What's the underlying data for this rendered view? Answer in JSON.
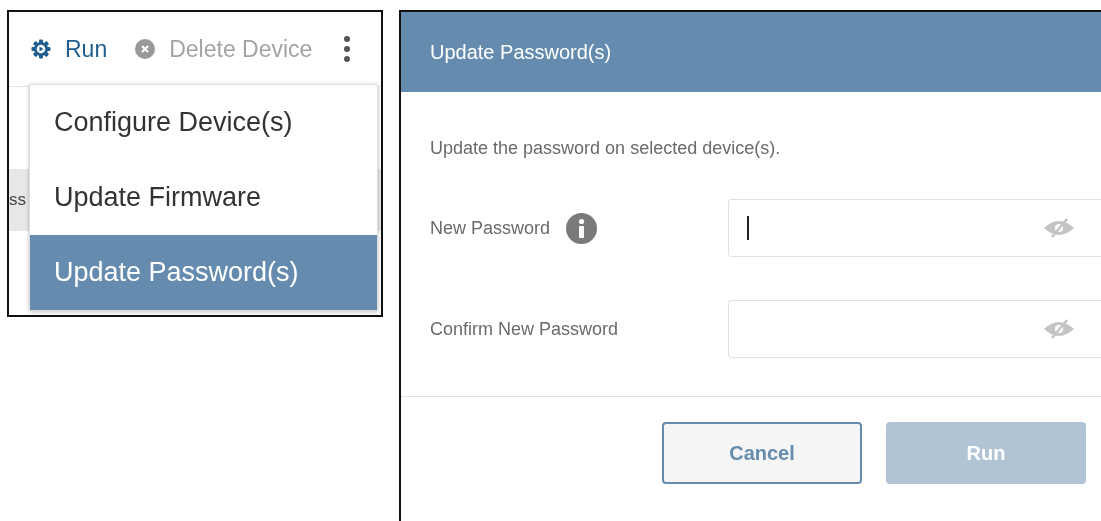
{
  "toolbar": [
    {
      "label": "Run",
      "kind": "run",
      "disabled": false
    },
    {
      "label": "Delete Device",
      "kind": "delete",
      "disabled": true
    }
  ],
  "table": {
    "column_1": "ss"
  },
  "menu": [
    {
      "label": "Configure Device(s)",
      "selected": false
    },
    {
      "label": "Update Firmware",
      "selected": false
    },
    {
      "label": "Update Password(s)",
      "selected": true
    }
  ],
  "dialog": {
    "title": "Update Password(s)",
    "description": "Update the password on selected device(s).",
    "fields": [
      {
        "label": "New Password",
        "info": true,
        "focused": true
      },
      {
        "label": "Confirm New Password",
        "info": false,
        "focused": false
      }
    ],
    "buttons": [
      {
        "label": "Cancel",
        "kind": "secondary",
        "disabled": false
      },
      {
        "label": "Run",
        "kind": "primary",
        "disabled": true
      }
    ]
  }
}
